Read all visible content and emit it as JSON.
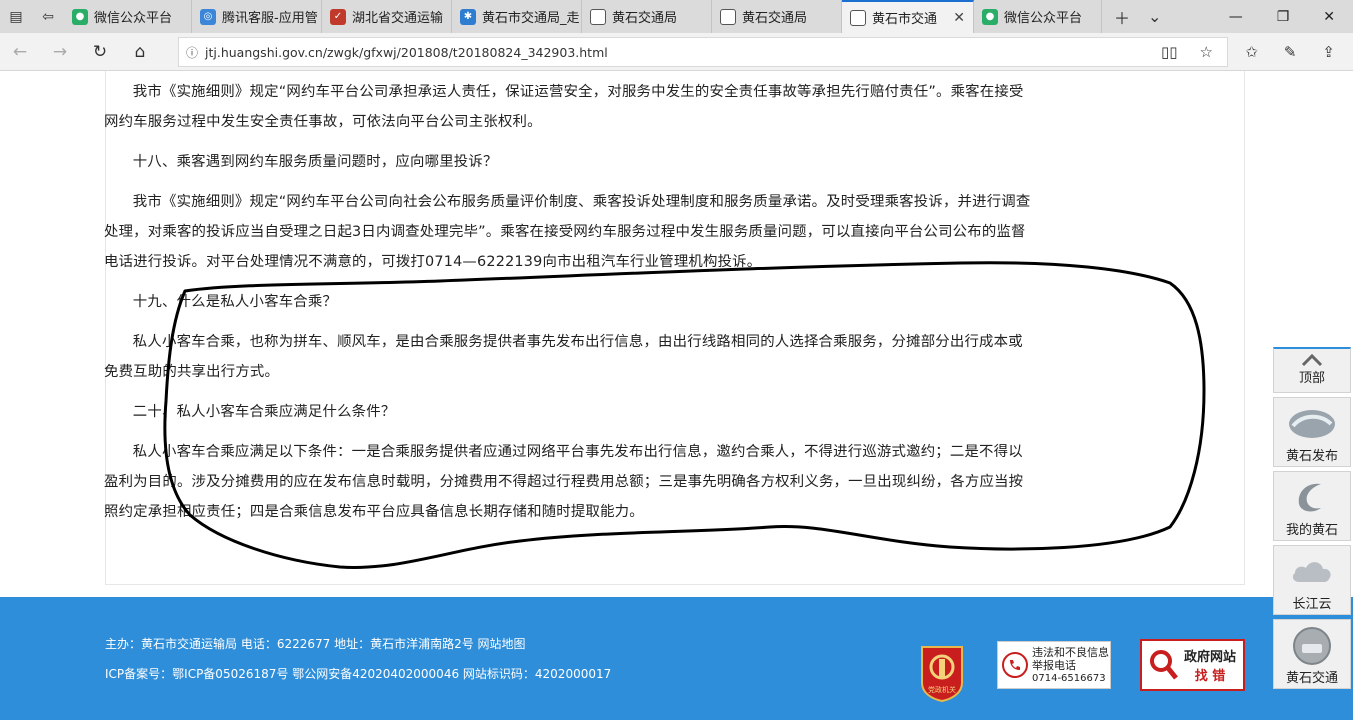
{
  "tabs": [
    {
      "title": "微信公众平台",
      "color": "#2aae67",
      "glyph": "●"
    },
    {
      "title": "腾讯客服-应用管",
      "color": "#3b86d8",
      "glyph": "◎"
    },
    {
      "title": "湖北省交通运输",
      "color": "#c0392b",
      "glyph": "✓"
    },
    {
      "title": "黄石市交通局_走",
      "color": "#2e7dd1",
      "glyph": "✱"
    },
    {
      "title": "黄石交通局",
      "color": "#ffffff",
      "glyph": "▭"
    },
    {
      "title": "黄石交通局",
      "color": "#ffffff",
      "glyph": "▭"
    },
    {
      "title": "黄石市交通",
      "color": "#ffffff",
      "glyph": "▭"
    },
    {
      "title": "微信公众平台",
      "color": "#2aae67",
      "glyph": "●"
    }
  ],
  "url": "jtj.huangshi.gov.cn/zwgk/gfxwj/201808/t20180824_342903.html",
  "article": {
    "paragraphs": [
      "我市《实施细则》规定“网约车平台公司承担承运人责任，保证运营安全，对服务中发生的安全责任事故等承担先行赔付责任”。乘客在接受网约车服务过程中发生安全责任事故，可依法向平台公司主张权利。",
      "十八、乘客遇到网约车服务质量问题时，应向哪里投诉？",
      "我市《实施细则》规定“网约车平台公司向社会公布服务质量评价制度、乘客投诉处理制度和服务质量承诺。及时受理乘客投诉，并进行调查处理，对乘客的投诉应当自受理之日起3日内调查处理完毕”。乘客在接受网约车服务过程中发生服务质量问题，可以直接向平台公司公布的监督电话进行投诉。对平台处理情况不满意的，可拨打0714—6222139向市出租汽车行业管理机构投诉。",
      "十九、什么是私人小客车合乘？",
      "私人小客车合乘，也称为拼车、顺风车，是由合乘服务提供者事先发布出行信息，由出行线路相同的人选择合乘服务，分摊部分出行成本或免费互助的共享出行方式。",
      "二十、私人小客车合乘应满足什么条件？",
      "私人小客车合乘应满足以下条件：一是合乘服务提供者应通过网络平台事先发布出行信息，邀约合乘人，不得进行巡游式邀约；二是不得以盈利为目的。涉及分摊费用的应在发布信息时载明，分摊费用不得超过行程费用总额；三是事先明确各方权利义务，一旦出现纠纷，各方应当按照约定承担相应责任；四是合乘信息发布平台应具备信息长期存储和随时提取能力。"
    ]
  },
  "footer": {
    "line1": "主办：黄石市交通运输局   电话：6222677   地址：黄石市洋浦南路2号   网站地图",
    "line2": "ICP备案号：鄂ICP备05026187号   鄂公网安备42020402000046   网站标识码：4202000017",
    "party_badge": "党政机关",
    "report_line1": "违法和不良信息",
    "report_line2": "举报电话",
    "report_phone": "0714-6516673",
    "govfix_line1": "政府网站",
    "govfix_line2": "找 错"
  },
  "sidebar": {
    "top": "顶部",
    "items": [
      "黄石发布",
      "我的黄石",
      "长江云",
      "黄石交通"
    ]
  },
  "colors": {
    "footer_bg": "#2e8ed9",
    "active_tab_accent": "#1a6fd1",
    "annotation_stroke": "#000000"
  }
}
